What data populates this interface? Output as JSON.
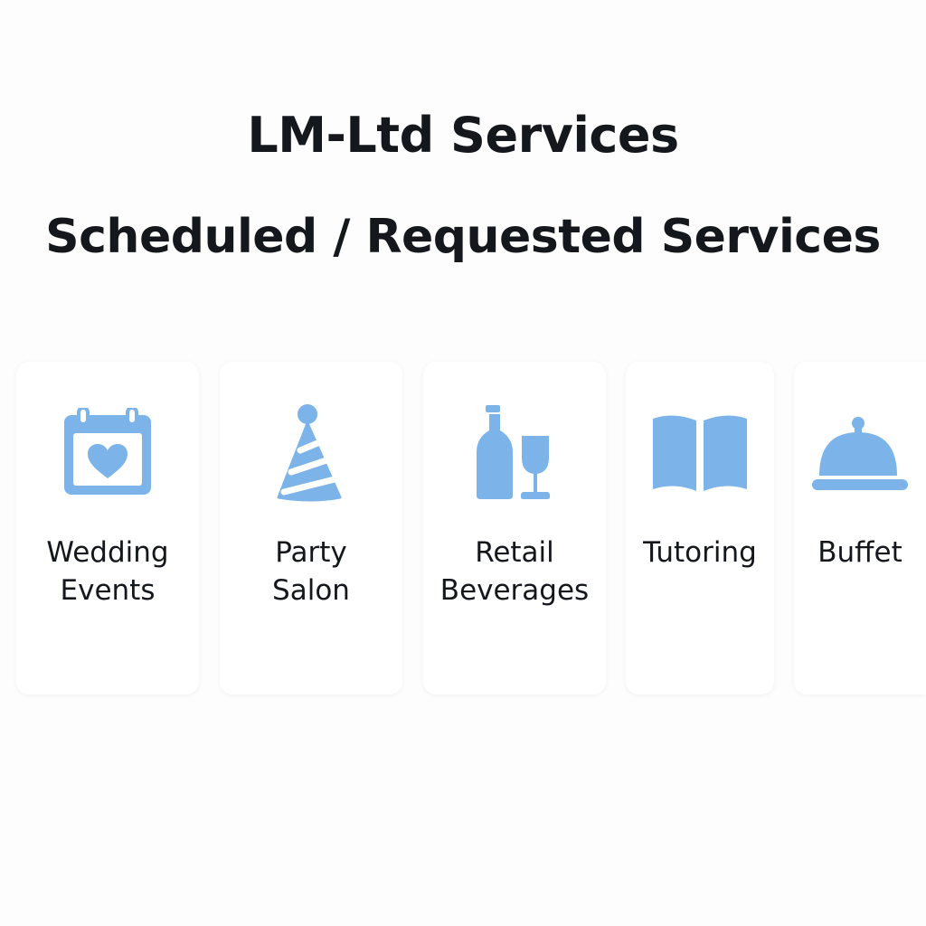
{
  "header": {
    "title": "LM-Ltd Services",
    "subtitle": "Scheduled / Requested Services"
  },
  "accent_color": "#7cb4ea",
  "services": [
    {
      "icon": "calendar-heart-icon",
      "label_line1": "Wedding",
      "label_line2": "Events"
    },
    {
      "icon": "party-hat-icon",
      "label_line1": "Party",
      "label_line2": "Salon"
    },
    {
      "icon": "bottle-glass-icon",
      "label_line1": "Retail",
      "label_line2": "Beverages"
    },
    {
      "icon": "open-book-icon",
      "label_line1": "Tutoring",
      "label_line2": ""
    },
    {
      "icon": "food-cloche-icon",
      "label_line1": "Buffet",
      "label_line2": ""
    }
  ]
}
